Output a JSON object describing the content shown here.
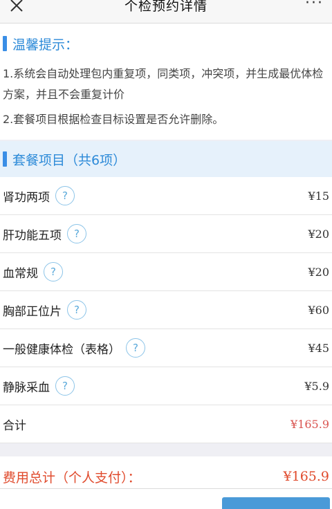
{
  "header": {
    "title": "个检预约详情",
    "close_icon": "close-icon",
    "more_label": "···"
  },
  "tips": {
    "heading": "温馨提示：",
    "line1": "1.系统会自动处理包内重复项，同类项，冲突项，并生成最优体检方案，并且不会重复计价",
    "line2": "2.套餐项目根据检查目标设置是否允许删除。"
  },
  "package": {
    "heading": "套餐项目（共6项）",
    "items": [
      {
        "name": "肾功两项",
        "price": "¥15"
      },
      {
        "name": "肝功能五项",
        "price": "¥20"
      },
      {
        "name": "血常规",
        "price": "¥20"
      },
      {
        "name": "胸部正位片",
        "price": "¥60"
      },
      {
        "name": "一般健康体检（表格）",
        "price": "¥45"
      },
      {
        "name": "静脉采血",
        "price": "¥5.9"
      }
    ],
    "help_glyph": "?",
    "total_label": "合计",
    "total_value": "¥165.9"
  },
  "fee": {
    "label": "费用总计（个人支付）：",
    "amount": "¥165.9"
  },
  "colors": {
    "accent": "#3a8ee6",
    "section_bg": "#e6f1fb",
    "price_red": "#e04b2d"
  }
}
